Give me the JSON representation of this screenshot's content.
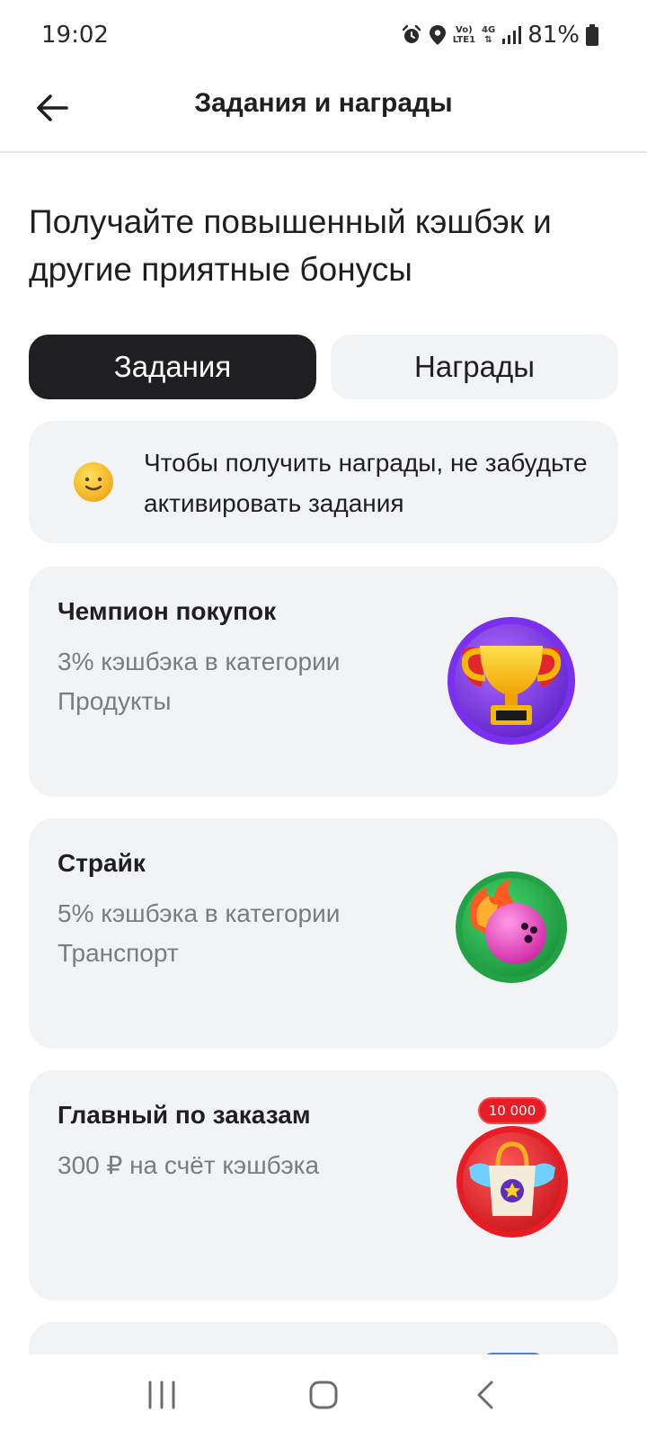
{
  "status_bar": {
    "time": "19:02",
    "battery": "81%",
    "volte_label_1": "Vo)",
    "volte_label_2": "LTE1",
    "network_label": "4G",
    "icons": [
      "alarm-icon",
      "location-icon",
      "volte-icon",
      "network-4g-icon",
      "signal-icon",
      "battery-icon"
    ]
  },
  "app_bar": {
    "title": "Задания и награды",
    "back_icon": "arrow-left-icon"
  },
  "headline": "Получайте повышенный кэшбэк и другие приятные бонусы",
  "tabs": [
    {
      "label": "Задания",
      "active": true
    },
    {
      "label": "Награды",
      "active": false
    }
  ],
  "info": {
    "icon": "smiley-icon",
    "text": "Чтобы получить награды, не забудьте активировать задания"
  },
  "tasks": [
    {
      "title": "Чемпион покупок",
      "description": "3% кэшбэка в категории Продукты",
      "icon": "trophy-badge-icon"
    },
    {
      "title": "Страйк",
      "description": "5% кэшбэка в категории Транспорт",
      "icon": "bowling-ball-badge-icon"
    },
    {
      "title": "Главный по заказам",
      "description": "300 ₽ на счёт кэшбэка",
      "icon": "shopping-bag-badge-icon",
      "badge_label": "10 000"
    }
  ],
  "colors": {
    "accent_dark": "#1f1f22",
    "card_bg": "#f2f3f5",
    "muted_text": "#7a7c82"
  },
  "nav_bar": {
    "icons": [
      "recent-apps-icon",
      "home-icon",
      "back-icon"
    ]
  }
}
